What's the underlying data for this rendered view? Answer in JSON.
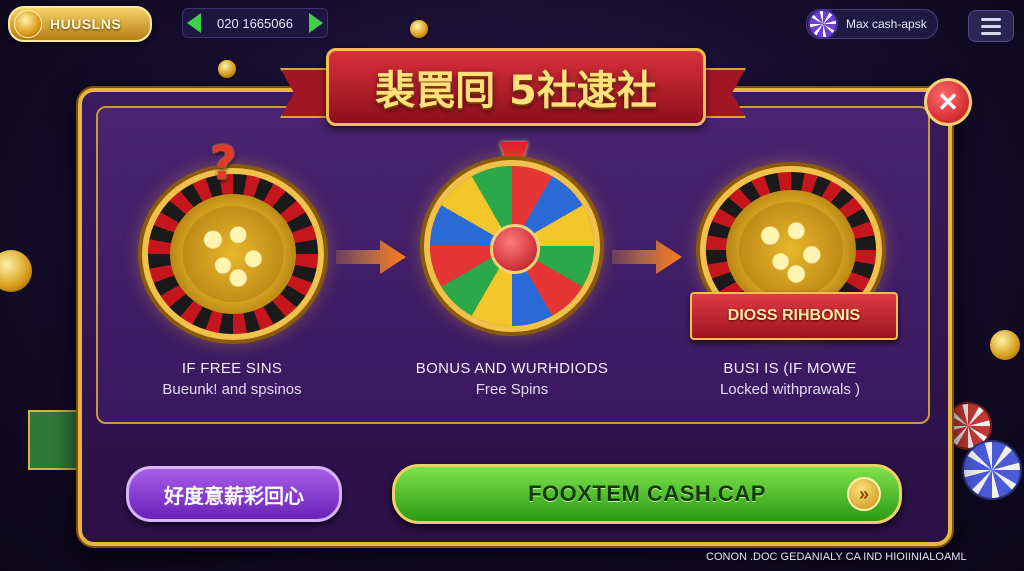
{
  "header": {
    "logo_text": "HUUSLNS",
    "balance": "020 1665066",
    "max_cash_label": "Max cash-apsk"
  },
  "dialog": {
    "title": "裴罠囘 5社逮社",
    "steps": [
      {
        "title": "IF FREE SINS",
        "subtitle": "Bueunk! and spsinos"
      },
      {
        "title": "BONUS AND WURHDIODS",
        "subtitle": "Free Spins"
      },
      {
        "title": "BUSI IS (IF MOWE",
        "subtitle": "Locked withprawals )"
      }
    ],
    "ribbon_text": "DIOSS RIHBONIS",
    "close_label": "✕"
  },
  "buttons": {
    "secondary_label": "好度意薪彩回心",
    "primary_label": "FOOXTEM CASH.CAP",
    "primary_go": "»"
  },
  "footer": {
    "note": "CONON .DOC GEDANIALY CA IND HIOIINIALOAML"
  },
  "colors": {
    "accent_gold": "#e8b640",
    "dialog_bg": "#3b1a5e",
    "primary_green": "#4fc02a",
    "secondary_purple": "#8a3fd0",
    "banner_red": "#c2222e"
  }
}
